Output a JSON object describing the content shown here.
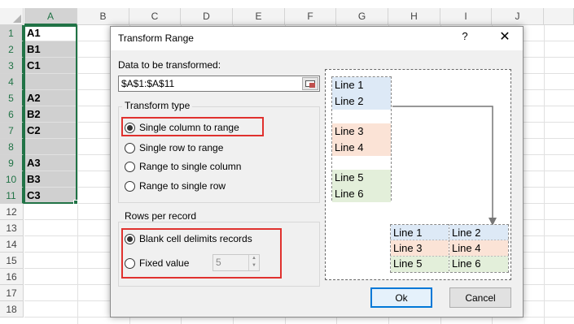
{
  "sheet": {
    "columns": [
      "A",
      "B",
      "C",
      "D",
      "E",
      "F",
      "G",
      "H",
      "I",
      "J"
    ],
    "rows": [
      "1",
      "2",
      "3",
      "4",
      "5",
      "6",
      "7",
      "8",
      "9",
      "10",
      "11",
      "12",
      "13",
      "14",
      "15",
      "16",
      "17",
      "18"
    ],
    "colA": [
      "A1",
      "B1",
      "C1",
      "",
      "A2",
      "B2",
      "C2",
      "",
      "A3",
      "B3",
      "C3"
    ]
  },
  "dialog": {
    "title": "Transform Range",
    "help": "?",
    "close": "✕",
    "data_label": "Data to be transformed:",
    "range_value": "$A$1:$A$11",
    "transform_type": {
      "title": "Transform type",
      "options": [
        "Single column to range",
        "Single row to range",
        "Range to single column",
        "Range to single row"
      ],
      "selected": "Single column to range"
    },
    "rows_per_record": {
      "title": "Rows per record",
      "blank_label": "Blank cell delimits records",
      "fixed_label": "Fixed value",
      "fixed_value": "5",
      "selected": "Blank cell delimits records"
    },
    "preview": {
      "source": [
        "Line 1",
        "Line 2",
        "",
        "Line 3",
        "Line 4",
        "",
        "Line 5",
        "Line 6"
      ],
      "result": [
        [
          "Line 1",
          "Line 2"
        ],
        [
          "Line 3",
          "Line 4"
        ],
        [
          "Line 5",
          "Line 6"
        ]
      ]
    },
    "ok_label": "Ok",
    "cancel_label": "Cancel"
  },
  "colors": {
    "excel_green": "#217346",
    "highlight_red": "#e0312e",
    "preview_blue": "#dde9f6",
    "preview_peach": "#fbe3d6",
    "preview_green": "#e3efda"
  }
}
